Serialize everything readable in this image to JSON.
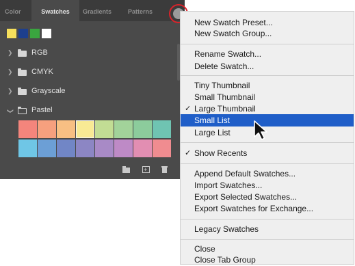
{
  "panel": {
    "tabs": [
      "Color",
      "Swatches",
      "Gradients",
      "Patterns"
    ],
    "active_tab": "Swatches",
    "recents": [
      "#f5df5c",
      "#1d3f8e",
      "#3aa53f",
      "#ffffff"
    ],
    "groups": [
      {
        "label": "RGB",
        "expanded": false
      },
      {
        "label": "CMYK",
        "expanded": false
      },
      {
        "label": "Grayscale",
        "expanded": false
      },
      {
        "label": "Pastel",
        "expanded": true
      }
    ],
    "pastel_swatches": [
      [
        "#f4857c",
        "#f6a07e",
        "#f8bf83",
        "#f8ea94",
        "#c2dd94",
        "#a2d39a",
        "#8ccc9c",
        "#6fc4b2"
      ],
      [
        "#6fc6e6",
        "#6c9fd6",
        "#7186c6",
        "#8c86c4",
        "#a88ac6",
        "#be8ac6",
        "#e28eb2",
        "#f08c90"
      ]
    ],
    "selected_swatch": "#f8ea94",
    "highlight_color": "#d8232a"
  },
  "menu": {
    "items": [
      "New Swatch Preset...",
      "New Swatch Group...",
      "Rename Swatch...",
      "Delete Swatch...",
      "Tiny Thumbnail",
      "Small Thumbnail",
      "Large Thumbnail",
      "Small List",
      "Large List",
      "Show Recents",
      "Append Default Swatches...",
      "Import Swatches...",
      "Export Selected Swatches...",
      "Export Swatches for Exchange...",
      "Legacy Swatches",
      "Close",
      "Close Tab Group"
    ],
    "check_mark": "✓",
    "checked": [
      "Large Thumbnail",
      "Show Recents"
    ],
    "highlighted": "Small List",
    "highlight_color": "#1f5ec8"
  }
}
